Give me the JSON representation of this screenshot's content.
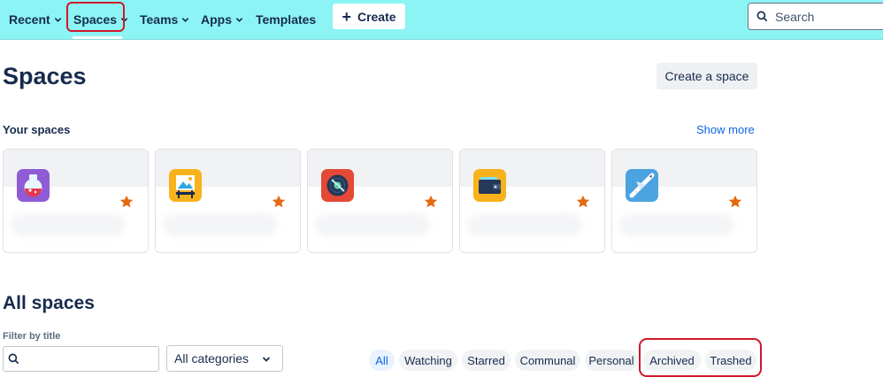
{
  "nav": {
    "recent": "Recent",
    "spaces": "Spaces",
    "teams": "Teams",
    "apps": "Apps",
    "templates": "Templates",
    "create": "Create",
    "search_placeholder": "Search"
  },
  "page": {
    "title": "Spaces",
    "create_space_label": "Create a space",
    "your_spaces_label": "Your spaces",
    "show_more_label": "Show more"
  },
  "cards": [
    {
      "icon": "potion-flask-icon",
      "starred": true
    },
    {
      "icon": "easel-painting-icon",
      "starred": true
    },
    {
      "icon": "vinyl-disc-icon",
      "starred": true
    },
    {
      "icon": "wallet-icon",
      "starred": true
    },
    {
      "icon": "airplane-icon",
      "starred": true
    }
  ],
  "all_spaces": {
    "title": "All spaces",
    "filter_label": "Filter by title",
    "filter_value": "",
    "category_selected": "All categories",
    "tabs": [
      "All",
      "Watching",
      "Starred",
      "Communal",
      "Personal",
      "Archived",
      "Trashed"
    ],
    "active_tab": "All"
  },
  "colors": {
    "nav_bg": "#8cf4f4",
    "highlight": "#d0182a",
    "star": "#e56910",
    "link": "#0c66e4"
  }
}
